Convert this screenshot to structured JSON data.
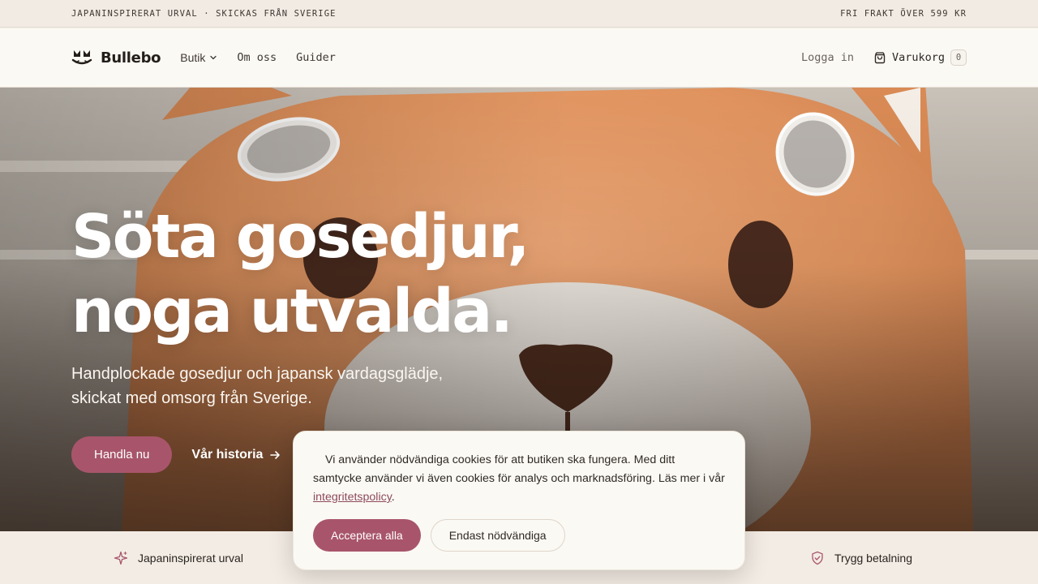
{
  "announcement": {
    "left": "JAPANINSPIRERAT URVAL · SKICKAS FRÅN SVERIGE",
    "right": "FRI FRAKT ÖVER 599 KR"
  },
  "header": {
    "brand": "Bullebo",
    "nav": [
      {
        "label": "Butik",
        "icon": "chevron-down-icon"
      },
      {
        "label": "Om oss"
      },
      {
        "label": "Guider"
      }
    ],
    "login_label": "Logga in",
    "cart_label": "Varukorg",
    "cart_count": "0"
  },
  "hero": {
    "title_line1": "Söta gosedjur,",
    "title_line2": "noga utvalda.",
    "subtitle_line1": "Handplockade gosedjur och japansk vardagsglädje,",
    "subtitle_line2": "skickat med omsorg från Sverige.",
    "primary_cta": "Handla nu",
    "secondary_cta": "Vår historia"
  },
  "trust": {
    "left_label": "Japaninspirerat urval",
    "left_icon": "sparkle-icon",
    "right_label": "Trygg betalning",
    "right_icon": "shield-check-icon"
  },
  "cookie": {
    "text_before": "Vi använder nödvändiga cookies för att butiken ska fungera. Med ditt samtycke använder vi även cookies för analys och marknadsföring. Läs mer i vår ",
    "link_text": "integritetspolicy",
    "text_after": ".",
    "accept_label": "Acceptera alla",
    "essential_label": "Endast nödvändiga"
  },
  "colors": {
    "accent": "#a8556b",
    "header_bg": "#fbf9f4",
    "announce_bg": "#f1ebe4",
    "plush_orange": "#e39a68"
  }
}
